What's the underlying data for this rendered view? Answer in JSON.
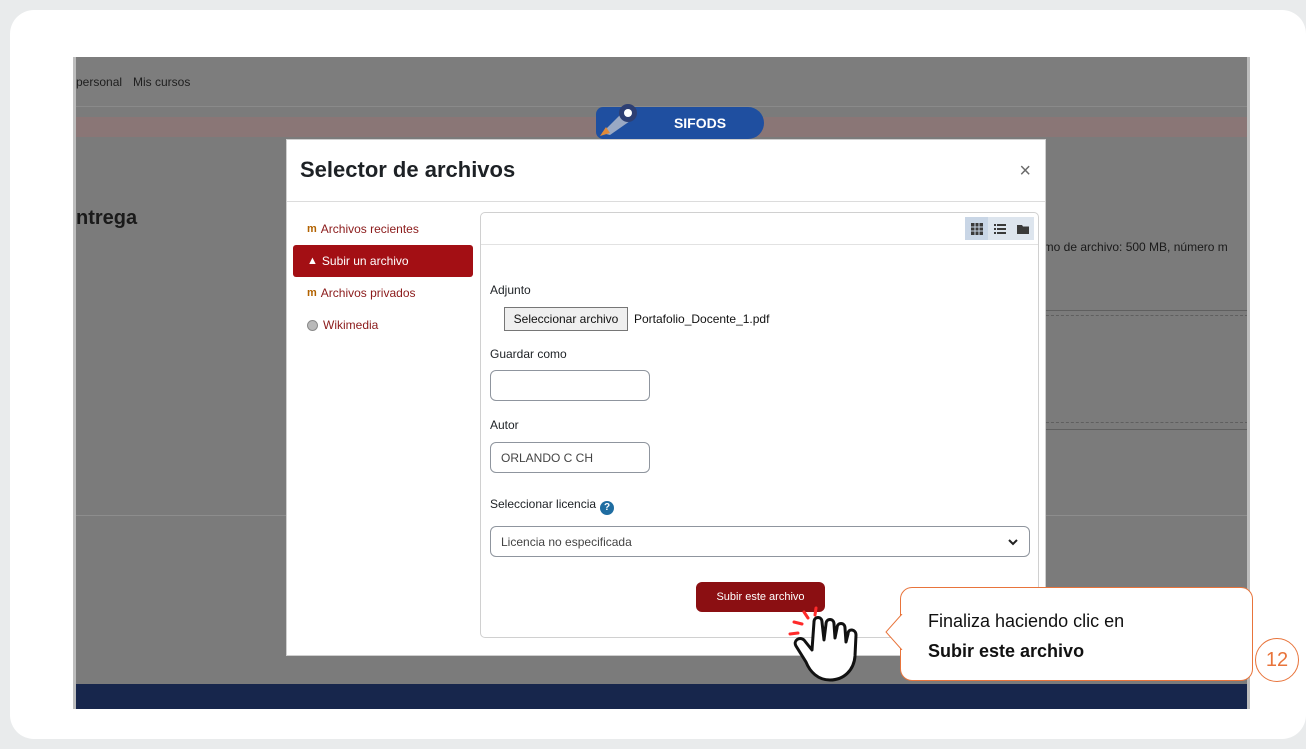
{
  "background": {
    "nav_items": [
      "personal",
      "Mis cursos"
    ],
    "logo_text": "SIFODS",
    "page_heading": "ntrega",
    "right_info": "imo de archivo: 500 MB, número m"
  },
  "modal": {
    "title": "Selector de archivos",
    "close": "×",
    "repositories": [
      {
        "label": "Archivos recientes",
        "icon": "moodle-icon",
        "active": false
      },
      {
        "label": "Subir un archivo",
        "icon": "upload-icon",
        "active": true
      },
      {
        "label": "Archivos privados",
        "icon": "moodle-icon",
        "active": false
      },
      {
        "label": "Wikimedia",
        "icon": "wikimedia-icon",
        "active": false
      }
    ],
    "view_buttons": [
      "grid-view-icon",
      "list-view-icon",
      "folder-view-icon"
    ],
    "form": {
      "attachment_label": "Adjunto",
      "file_button": "Seleccionar archivo",
      "file_name": "Portafolio_Docente_1.pdf",
      "save_as_label": "Guardar como",
      "save_as_value": "",
      "author_label": "Autor",
      "author_value": "ORLANDO C CH",
      "license_label": "Seleccionar licencia",
      "license_value": "Licencia no especificada",
      "submit_label": "Subir este archivo"
    }
  },
  "callout": {
    "line1": "Finaliza haciendo clic en",
    "line2": "Subir este archivo",
    "step": "12",
    "accent": "#e8743b"
  },
  "colors": {
    "primary_dark_red": "#8b0f12",
    "active_red": "#a30f14",
    "footer_navy": "#17264c",
    "logo_blue": "#1f4fa0"
  }
}
